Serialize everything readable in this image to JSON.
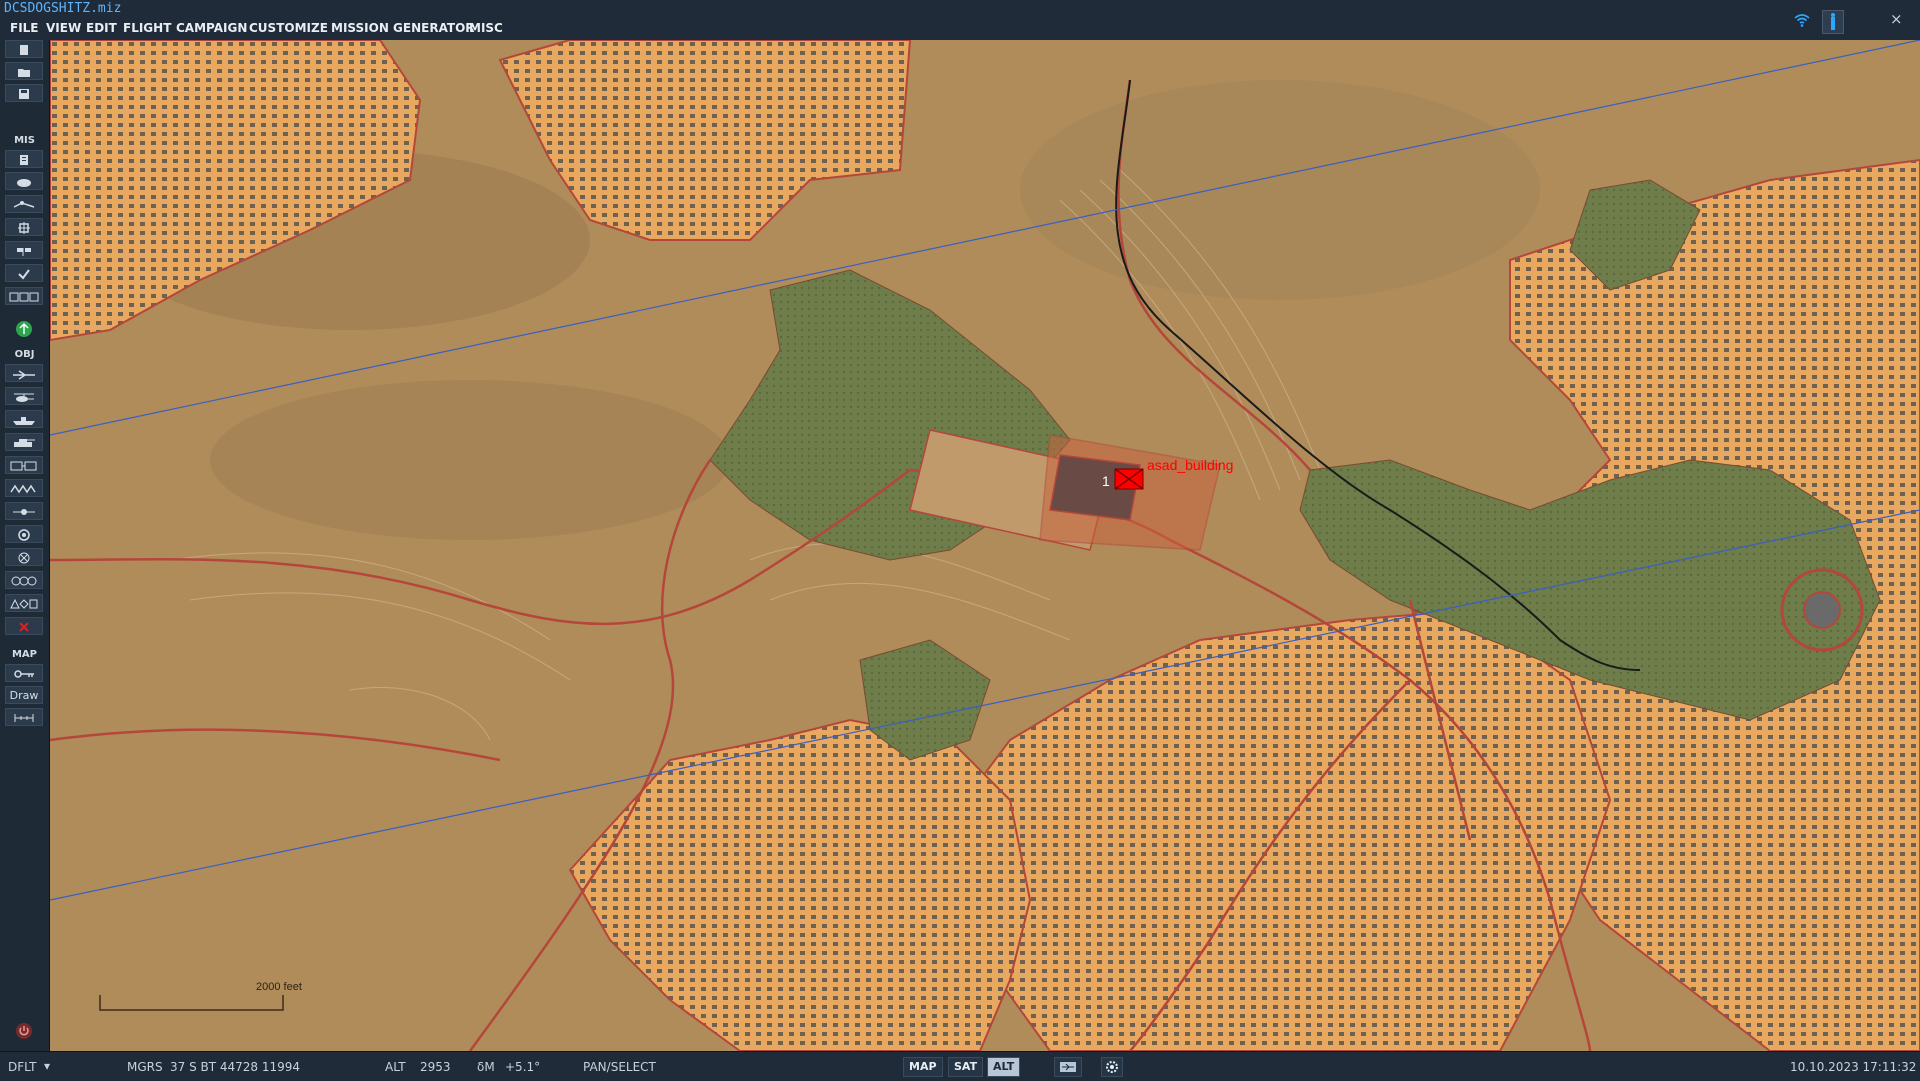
{
  "window": {
    "title": "DCSDOGSHITZ.miz",
    "close_glyph": "×"
  },
  "menu": [
    "FILE",
    "VIEW",
    "EDIT",
    "FLIGHT",
    "CAMPAIGN",
    "CUSTOMIZE",
    "MISSION GENERATOR",
    "MISC"
  ],
  "toolbar": {
    "section_mis": "MIS",
    "section_obj": "OBJ",
    "section_map": "MAP",
    "draw_label": "Draw",
    "icons": {
      "file": [
        "new-file-icon",
        "open-folder-icon",
        "save-icon"
      ],
      "mis": [
        "briefing-icon",
        "weather-icon",
        "route-icon",
        "target-icon",
        "flag-icon",
        "check-icon",
        "triggers-icon",
        "up-arrow-icon"
      ],
      "obj": [
        "plane-icon",
        "helicopter-icon",
        "ship-icon",
        "vehicle-icon",
        "static-object-icon",
        "trees-icon",
        "waypoint-icon",
        "zone-icon",
        "nav-point-icon",
        "formation-icon",
        "shapes-icon",
        "delete-icon"
      ],
      "map": [
        "map-key-icon",
        "ruler-icon"
      ]
    }
  },
  "map": {
    "object_label": "asad_building",
    "group_number": "1",
    "scale_label": "2000 feet",
    "colors": {
      "urban": "#e8a860",
      "terrain": "#b08c5a",
      "forest": "#6e7d4a",
      "road": "#b5473a",
      "marker": "#ff0000",
      "airway": "#3a5fc4"
    }
  },
  "status": {
    "profile": "DFLT",
    "coord_system": "MGRS",
    "coordinates": "37 S BT 44728 11994",
    "alt_label": "ALT",
    "alt_value": "2953",
    "delta_label": "δM",
    "delta_value": "+5.1°",
    "mode": "PAN/SELECT",
    "btn_map": "MAP",
    "btn_sat": "SAT",
    "btn_alt": "ALT",
    "datetime": "10.10.2023 17:11:32"
  }
}
